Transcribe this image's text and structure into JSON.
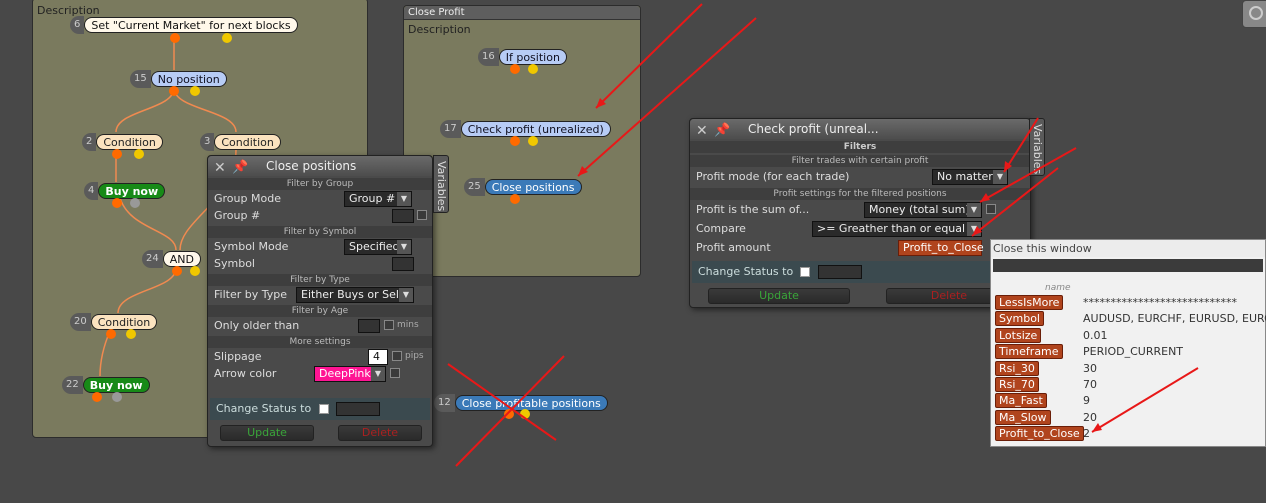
{
  "workspace_left": {
    "description": "Description"
  },
  "workspace_close": {
    "title": "Close Profit",
    "description": "Description"
  },
  "blocks": {
    "b6": {
      "num": "6",
      "label": "Set \"Current Market\" for next blocks"
    },
    "b15": {
      "num": "15",
      "label": "No position"
    },
    "b2": {
      "num": "2",
      "label": "Condition"
    },
    "b3": {
      "num": "3",
      "label": "Condition"
    },
    "b4": {
      "num": "4",
      "label": "Buy now"
    },
    "b24": {
      "num": "24",
      "label": "AND"
    },
    "b20": {
      "num": "20",
      "label": "Condition"
    },
    "b22": {
      "num": "22",
      "label": "Buy now"
    },
    "b16": {
      "num": "16",
      "label": "If position"
    },
    "b17": {
      "num": "17",
      "label": "Check profit (unrealized)"
    },
    "b25": {
      "num": "25",
      "label": "Close positions"
    },
    "b12": {
      "num": "12",
      "label": "Close profitable positions"
    }
  },
  "close_positions_dialog": {
    "title": "Close positions",
    "variables_tab": "Variables",
    "sec_group": "Filter by Group",
    "group_mode_label": "Group Mode",
    "group_mode_value": "Group #",
    "group_num_label": "Group #",
    "sec_symbol": "Filter by Symbol",
    "symbol_mode_label": "Symbol Mode",
    "symbol_mode_value": "Specified",
    "symbol_label": "Symbol",
    "sec_type": "Filter by Type",
    "filter_type_label": "Filter by Type",
    "filter_type_value": "Either Buys or Sells",
    "sec_age": "Filter by Age",
    "older_label": "Only older than",
    "older_unit": "mins",
    "sec_more": "More settings",
    "slippage_label": "Slippage",
    "slippage_value": "4",
    "slippage_unit": "pips",
    "arrow_color_label": "Arrow color",
    "arrow_color_value": "DeepPink",
    "change_status_label": "Change Status to",
    "update_label": "Update",
    "delete_label": "Delete"
  },
  "check_profit_dialog": {
    "title": "Check profit (unreal...",
    "variables_tab": "Variables",
    "sec_filters": "Filters",
    "sec_filter_trades": "Filter trades with certain profit",
    "profit_mode_label": "Profit mode (for each trade)",
    "profit_mode_value": "No matter",
    "sec_profit_settings": "Profit settings for the filtered positions",
    "profit_sum_label": "Profit is the sum of...",
    "profit_sum_value": "Money (total sum)",
    "compare_label": "Compare",
    "compare_value": ">= Greather than or equal to",
    "amount_label": "Profit amount",
    "amount_value": "Profit_to_Close",
    "change_status_label": "Change Status to",
    "update_label": "Update",
    "delete_label": "Delete"
  },
  "variables_window": {
    "title": "Close this window",
    "col_name": "name",
    "rows": [
      {
        "name": "LessIsMore",
        "value": "****************************"
      },
      {
        "name": "Symbol",
        "value": "AUDUSD, EURCHF, EURUSD, EURCAD"
      },
      {
        "name": "Lotsize",
        "value": "0.01"
      },
      {
        "name": "Timeframe",
        "value": "PERIOD_CURRENT"
      },
      {
        "name": "Rsi_30",
        "value": "30"
      },
      {
        "name": "Rsi_70",
        "value": "70"
      },
      {
        "name": "Ma_Fast",
        "value": "9"
      },
      {
        "name": "Ma_Slow",
        "value": "20"
      },
      {
        "name": "Profit_to_Close",
        "value": "2"
      }
    ]
  },
  "colors": {
    "canvas": "#484848",
    "workspace": "#7a7a5e",
    "annotation_red": "#e81818",
    "variable_tag": "#b0441d"
  }
}
